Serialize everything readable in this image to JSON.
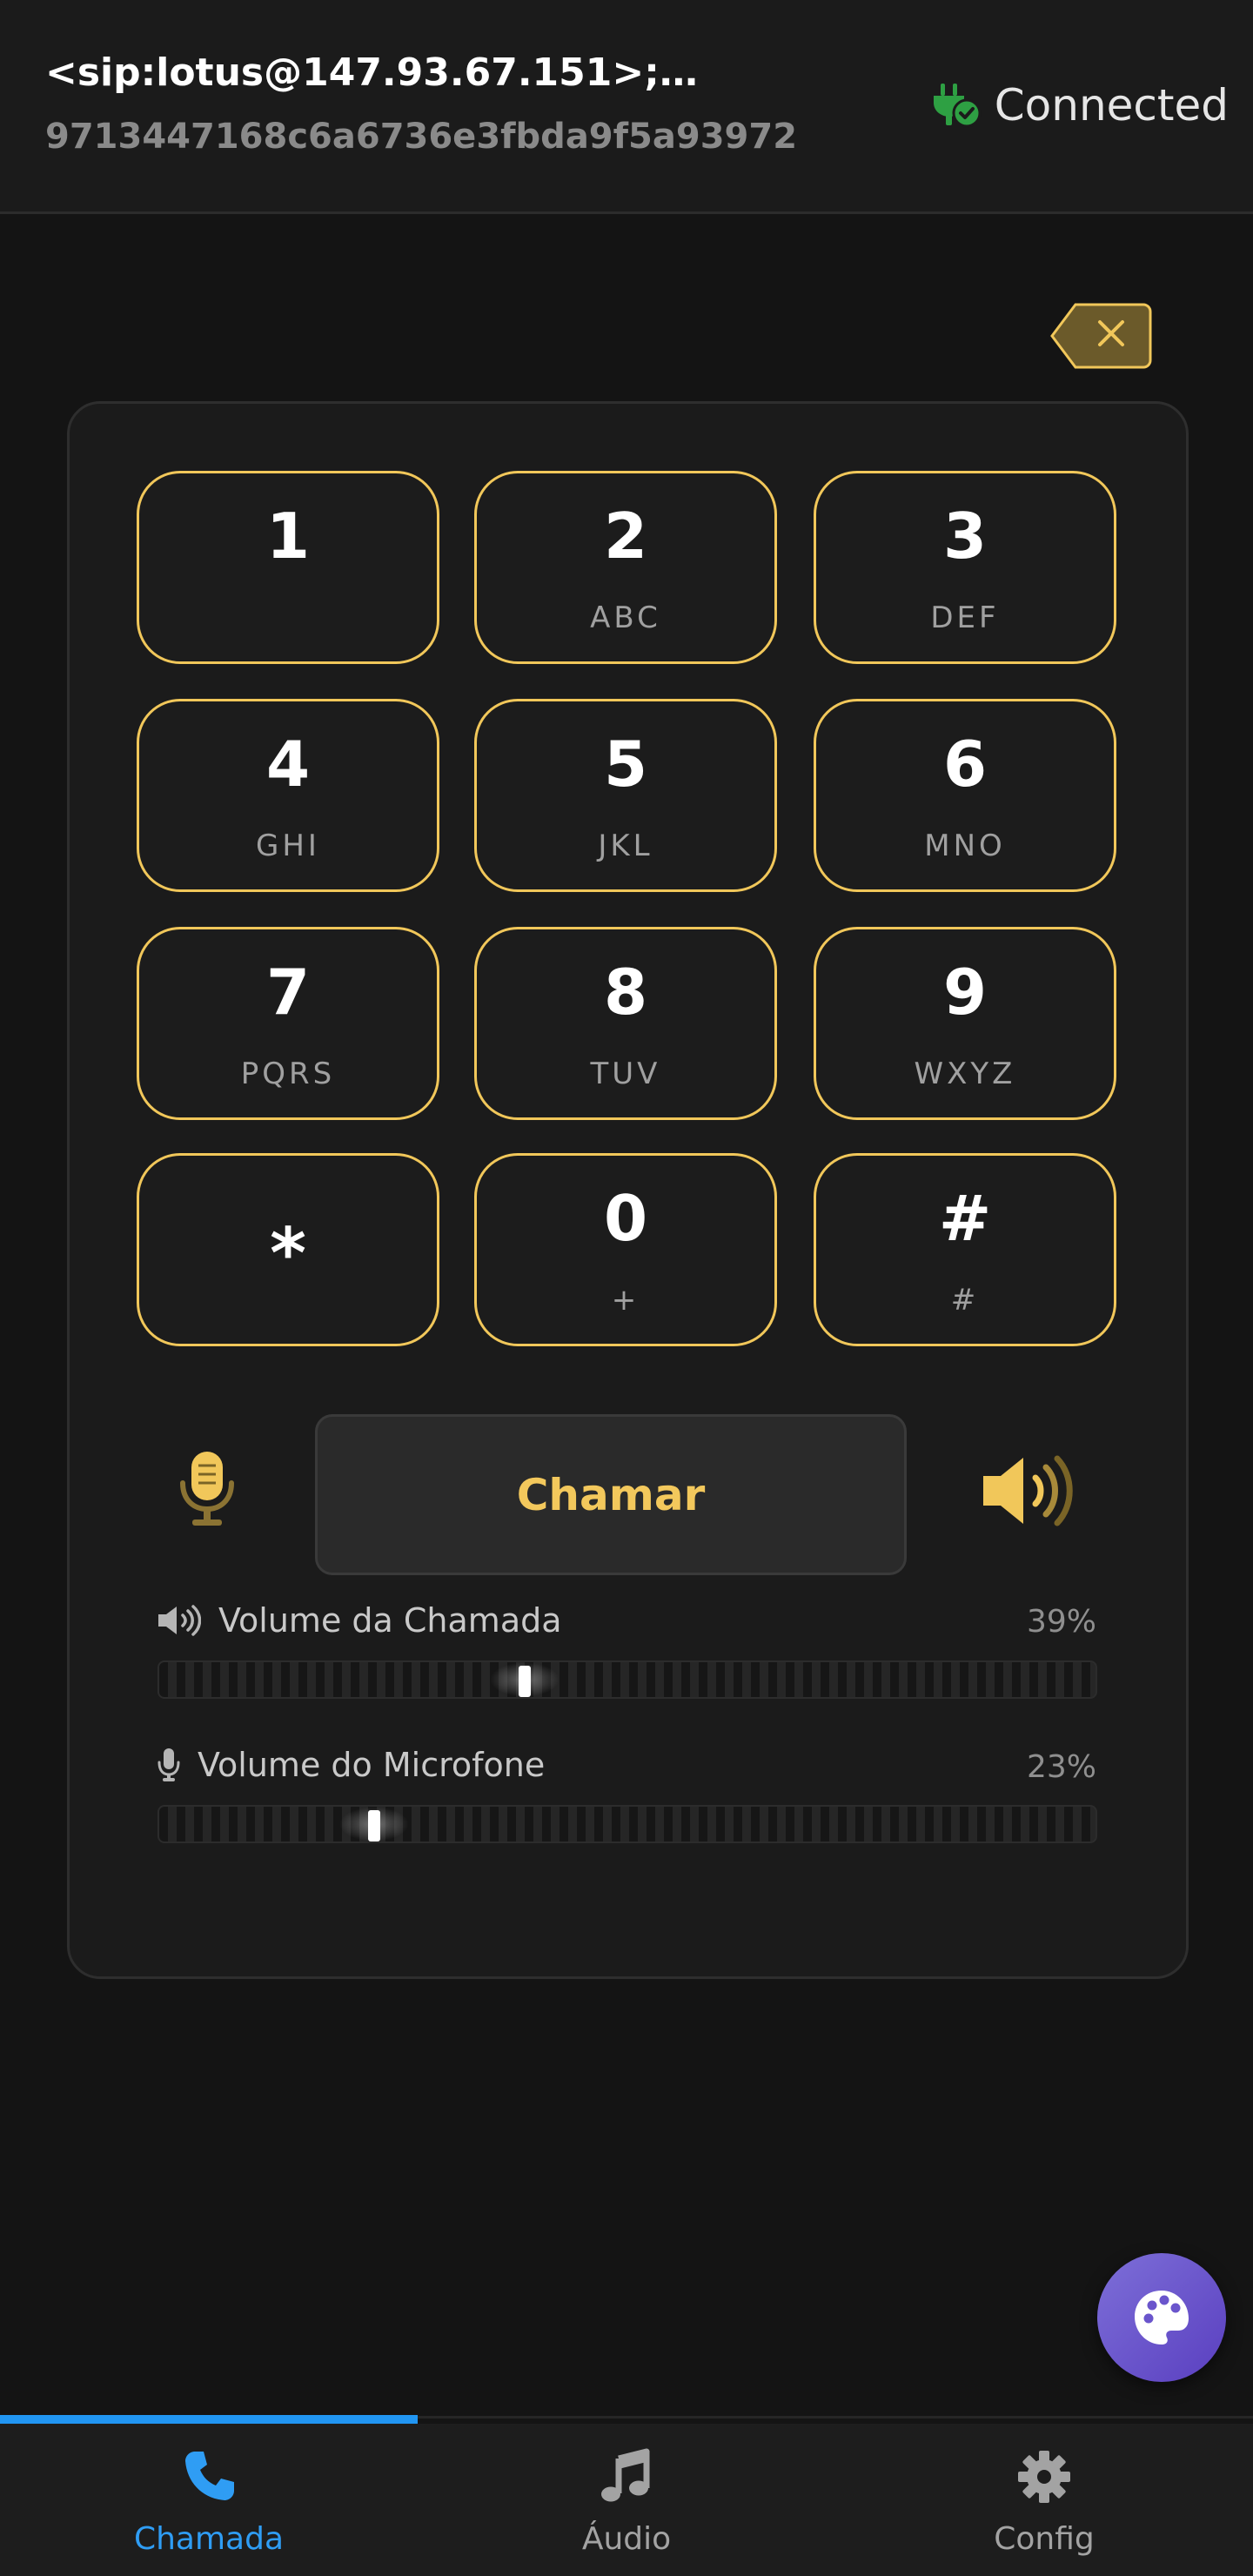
{
  "header": {
    "sip_uri": "<sip:lotus@147.93.67.151>;…",
    "sip_id": "9713447168c6a6736e3fbda9f5a93972",
    "status_label": "Connected",
    "status_color": "#2ea043"
  },
  "dialpad": {
    "keys": [
      {
        "digit": "1",
        "letters": ""
      },
      {
        "digit": "2",
        "letters": "ABC"
      },
      {
        "digit": "3",
        "letters": "DEF"
      },
      {
        "digit": "4",
        "letters": "GHI"
      },
      {
        "digit": "5",
        "letters": "JKL"
      },
      {
        "digit": "6",
        "letters": "MNO"
      },
      {
        "digit": "7",
        "letters": "PQRS"
      },
      {
        "digit": "8",
        "letters": "TUV"
      },
      {
        "digit": "9",
        "letters": "WXYZ"
      },
      {
        "digit": "*",
        "letters": ""
      },
      {
        "digit": "0",
        "letters": "+"
      },
      {
        "digit": "#",
        "letters": "#"
      }
    ],
    "accent_color": "#f1c75a"
  },
  "controls": {
    "call_label": "Chamar",
    "mic_icon": "microphone-icon",
    "speaker_icon": "speaker-icon",
    "backspace_icon": "backspace-icon"
  },
  "volume": {
    "call": {
      "label": "Volume da Chamada",
      "value_text": "39%",
      "value": 39
    },
    "mic": {
      "label": "Volume do Microfone",
      "value_text": "23%",
      "value": 23
    }
  },
  "fab": {
    "icon": "palette-icon"
  },
  "nav": {
    "items": [
      {
        "label": "Chamada",
        "icon": "phone-icon",
        "active": true
      },
      {
        "label": "Áudio",
        "icon": "music-note-icon",
        "active": false
      },
      {
        "label": "Config",
        "icon": "gear-icon",
        "active": false
      }
    ],
    "active_color": "#2f9df4"
  }
}
